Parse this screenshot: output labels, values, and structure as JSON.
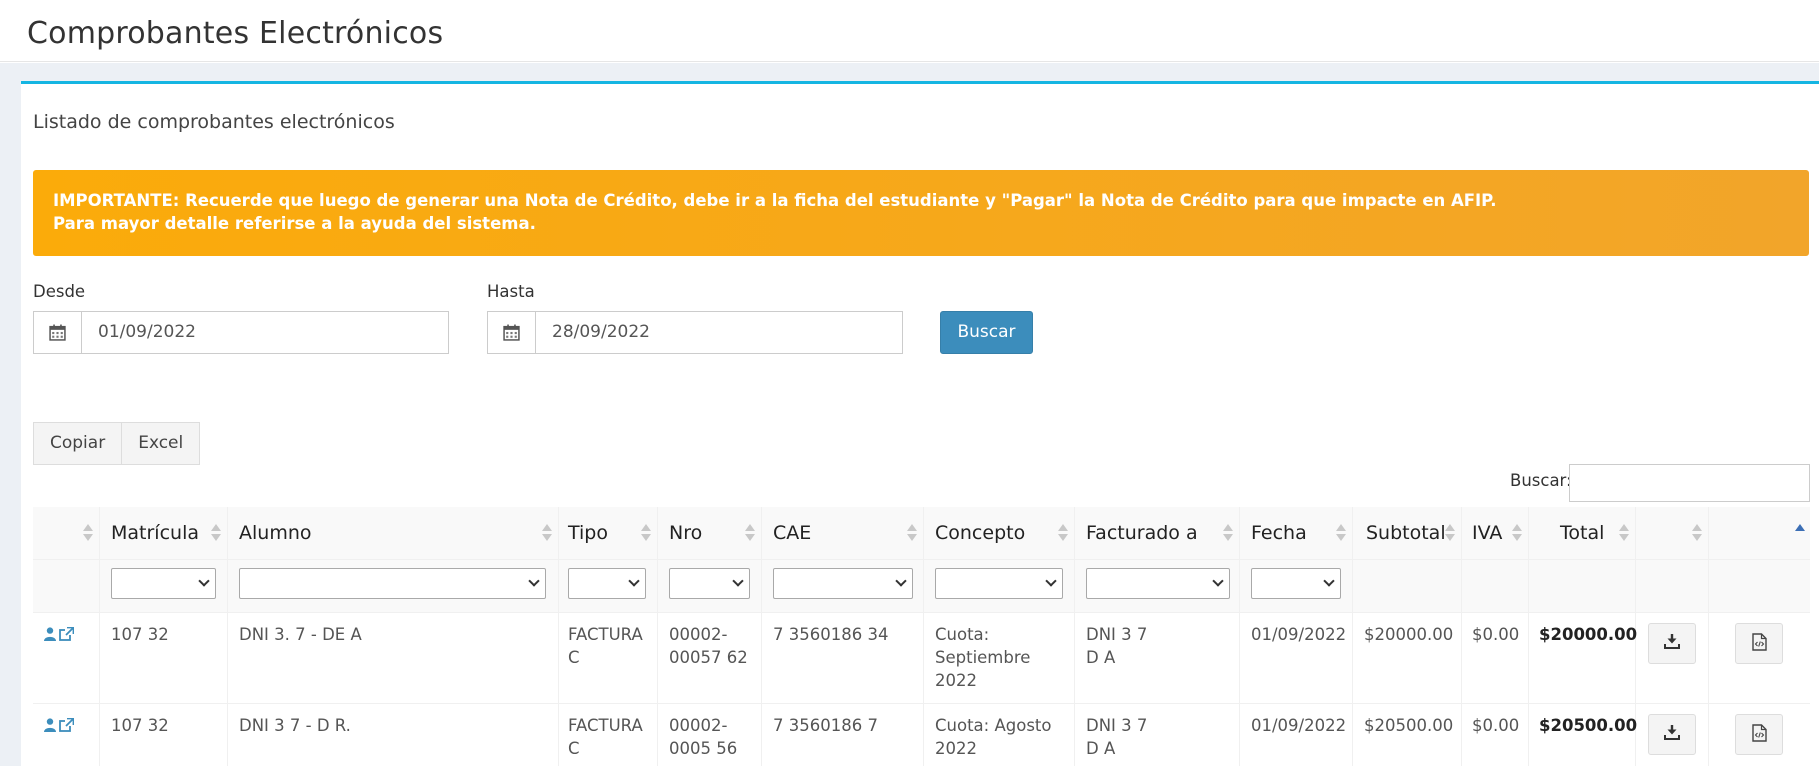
{
  "page": {
    "title": "Comprobantes Electrónicos"
  },
  "box": {
    "title": "Listado de comprobantes electrónicos"
  },
  "alert": {
    "line1": "IMPORTANTE: Recuerde que luego de generar una Nota de Crédito, debe ir a la ficha del estudiante y \"Pagar\" la Nota de Crédito para que impacte en AFIP.",
    "line2": "Para mayor detalle referirse a la ayuda del sistema."
  },
  "filters": {
    "desde_label": "Desde",
    "desde_value": "01/09/2022",
    "hasta_label": "Hasta",
    "hasta_value": "28/09/2022",
    "search_button": "Buscar"
  },
  "export_buttons": {
    "copy": "Copiar",
    "excel": "Excel"
  },
  "table_search": {
    "label": "Buscar:",
    "value": ""
  },
  "table": {
    "columns": [
      "",
      "Matrícula",
      "Alumno",
      "Tipo",
      "Nro",
      "CAE",
      "Concepto",
      "Facturado a",
      "Fecha",
      "Subtotal",
      "IVA",
      "Total",
      "",
      ""
    ],
    "rows": [
      {
        "matricula": "107  32",
        "alumno": "DNI 3.           7 - DE                   A",
        "tipo_1": "FACTURA",
        "tipo_2": "C",
        "nro_1": "00002-",
        "nro_2": "00057  62",
        "cae": "7   3560186          34",
        "concepto_1": "Cuota:",
        "concepto_2": "Septiembre",
        "concepto_3": "2022",
        "facturado_1": "DNI 3            7",
        "facturado_2": "D                    A",
        "fecha": "01/09/2022",
        "subtotal": "$20000.00",
        "iva": "$0.00",
        "total": "$20000.00"
      },
      {
        "matricula": "107  32",
        "alumno": "DNI 3           7 - D                    R.",
        "tipo_1": "FACTURA",
        "tipo_2": "C",
        "nro_1": "00002-",
        "nro_2": "0005  56",
        "cae": "7  3560186          7",
        "concepto_1": "Cuota: Agosto",
        "concepto_2": "2022",
        "concepto_3": "",
        "facturado_1": "DNI 3            7",
        "facturado_2": "D                    A",
        "fecha": "01/09/2022",
        "subtotal": "$20500.00",
        "iva": "$0.00",
        "total": "$20500.00"
      }
    ]
  },
  "icons": {
    "calendar": "calendar-icon",
    "user": "user-icon",
    "external_link": "external-link-icon",
    "download": "download-icon",
    "code_file": "file-code-icon"
  },
  "colors": {
    "accent": "#14b5e2",
    "alert": "#f6a90e",
    "primary": "#3c8dbc",
    "link_icon": "#3c8dbc"
  }
}
